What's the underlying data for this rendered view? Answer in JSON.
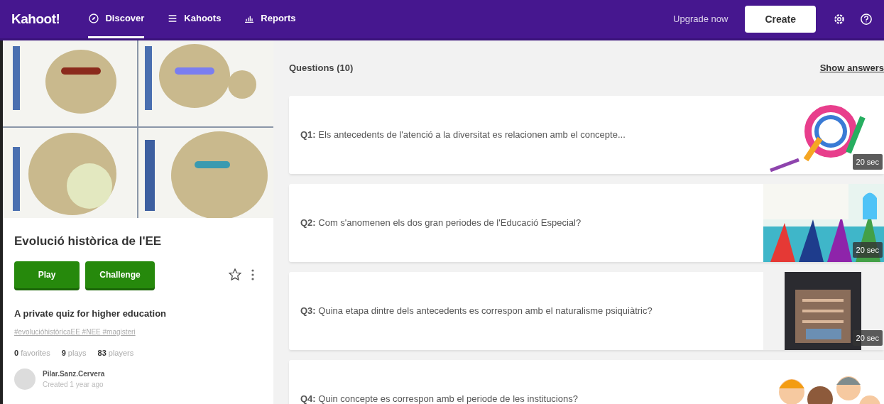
{
  "nav": {
    "logo": "Kahoot!",
    "items": [
      {
        "label": "Discover",
        "selected": true
      },
      {
        "label": "Kahoots",
        "selected": false
      },
      {
        "label": "Reports",
        "selected": false
      }
    ],
    "upgrade": "Upgrade now",
    "create": "Create"
  },
  "kahoot": {
    "title": "Evolució històrica de l'EE",
    "buttons": [
      "Play",
      "Challenge"
    ],
    "favorite": false,
    "description": "A private quiz for higher education",
    "tags": "#evolucióhistòricaEE #NEE #magisteri",
    "stats": [
      {
        "count": "0",
        "label": "favorites"
      },
      {
        "count": "9",
        "label": "plays"
      },
      {
        "count": "83",
        "label": "players"
      }
    ],
    "author": {
      "name": "Pilar.Sanz.Cervera",
      "created": "Created 1 year ago"
    }
  },
  "questions": {
    "heading": "Questions (10)",
    "show_answers": "Show answers",
    "items": [
      {
        "text": "**Q1:** Els antecedents de l'atenció a la diversitat es relacionen amb el concepte...",
        "time": "20 sec"
      },
      {
        "text": "**Q2:** Com s'anomenen els dos gran periodes de l'Educació Especial?",
        "time": "20 sec"
      },
      {
        "text": "**Q3:** Quina etapa dintre dels antecedents es correspon amb el naturalisme psiquiàtric?",
        "time": "20 sec"
      },
      {
        "text": "**Q4:** Quin concepte es correspon amb el periode de les institucions?"
      }
    ]
  }
}
